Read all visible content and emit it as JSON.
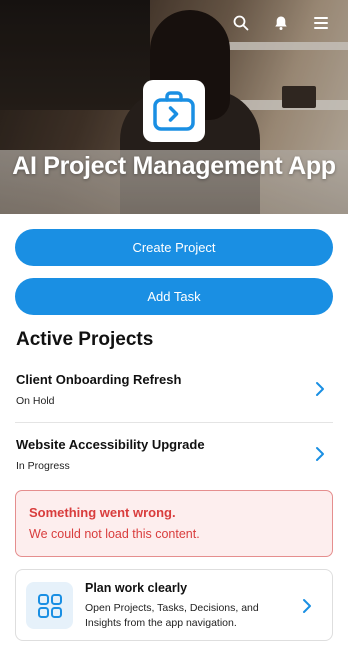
{
  "header": {
    "title": "AI Project Management App",
    "icons": [
      "search-icon",
      "notification-icon",
      "menu-icon"
    ]
  },
  "actions": {
    "create_project": "Create Project",
    "add_task": "Add Task"
  },
  "active_projects": {
    "title": "Active Projects",
    "items": [
      {
        "name": "Client Onboarding Refresh",
        "status": "On Hold"
      },
      {
        "name": "Website Accessibility Upgrade",
        "status": "In Progress"
      }
    ]
  },
  "error": {
    "title": "Something went wrong.",
    "message": "We could not load this content."
  },
  "info_card": {
    "title": "Plan work clearly",
    "description": "Open Projects, Tasks, Decisions, and Insights from the app navigation.",
    "icon": "grid-icon"
  },
  "colors": {
    "accent": "#1a8fe3",
    "error_text": "#d93d3d",
    "error_bg": "#fdeeee",
    "error_border": "#e58e8e"
  }
}
